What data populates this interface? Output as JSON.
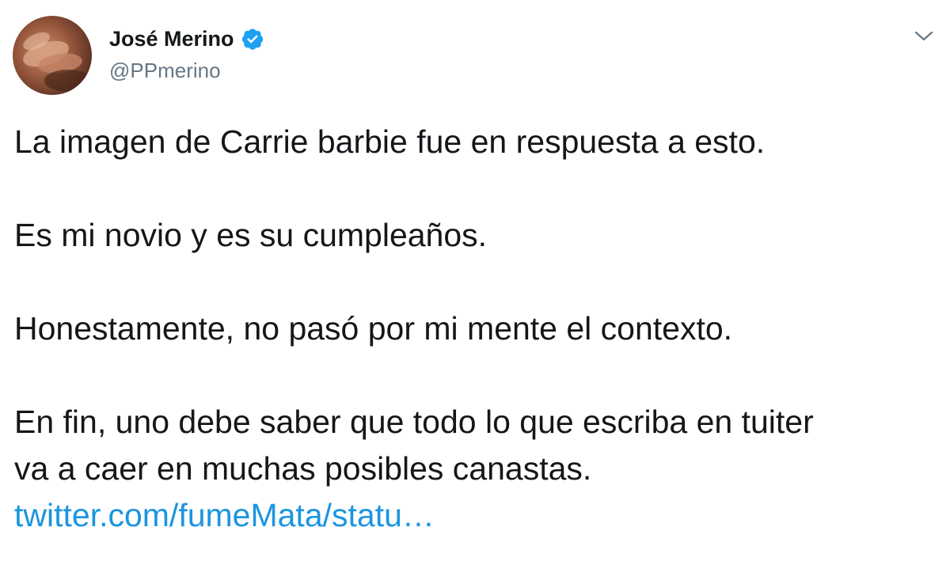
{
  "author": {
    "display_name": "José Merino",
    "handle": "@PPmerino",
    "verified": true,
    "avatar_icon": "profile-photo"
  },
  "menu_icon": "chevron-down-icon",
  "tweet": {
    "paragraphs": [
      [
        "La imagen de Carrie barbie fue en respuesta a esto."
      ],
      [
        "Es mi novio y es su cumpleaños."
      ],
      [
        "Honestamente, no pasó por mi mente el contexto."
      ],
      [
        "En fin, uno debe saber que todo lo que escriba en tuiter",
        "va a caer en muchas posibles canastas."
      ]
    ],
    "link_text": "twitter.com/fumeMata/statu…"
  },
  "colors": {
    "text": "#14171a",
    "secondary": "#657786",
    "link": "#1b95e0",
    "verified": "#1da1f2"
  }
}
